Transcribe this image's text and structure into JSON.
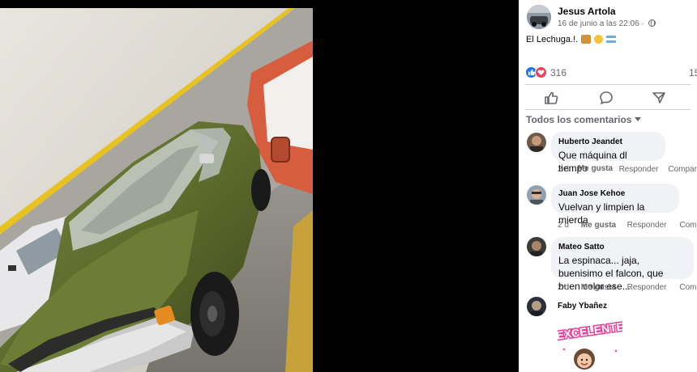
{
  "post": {
    "author": "Jesus Artola",
    "date": "16 de junio a las 22:06",
    "separator": "·",
    "caption": "El Lechuga.!.",
    "reaction_count": "316",
    "share_count": "15"
  },
  "comments_header": {
    "sort_label": "Todos los comentarios"
  },
  "comments": [
    {
      "author": "Huberto Jeandet",
      "text": "Que máquina dl tiempo",
      "time": "2 d",
      "like_label": "Me gusta",
      "reply_label": "Responder",
      "share_label": "Compartir"
    },
    {
      "author": "Juan Jose Kehoe",
      "text": "Vuelvan y limpien la mierda",
      "time": "2 d",
      "like_label": "Me gusta",
      "reply_label": "Responder",
      "share_label": "Compartir"
    },
    {
      "author": "Mateo Satto",
      "text": "La espinaca... jaja, buenisimo el falcon, que buen color ese...",
      "time": "2 d",
      "like_label": "Me gusta",
      "reply_label": "Responder",
      "share_label": "Compartir"
    },
    {
      "author": "Faby Ybañez",
      "sticker_text": "¡EXCELENTE!"
    }
  ],
  "colors": {
    "like_blue": "#1877f2",
    "love_red": "#f33e58",
    "car_green": "#5d6b2c",
    "pickup_red": "#d65d3e"
  },
  "icons": [
    "globe-icon",
    "like-reaction-icon",
    "love-reaction-icon",
    "like-action-icon",
    "comment-action-icon",
    "share-action-icon",
    "sort-caret-icon"
  ]
}
